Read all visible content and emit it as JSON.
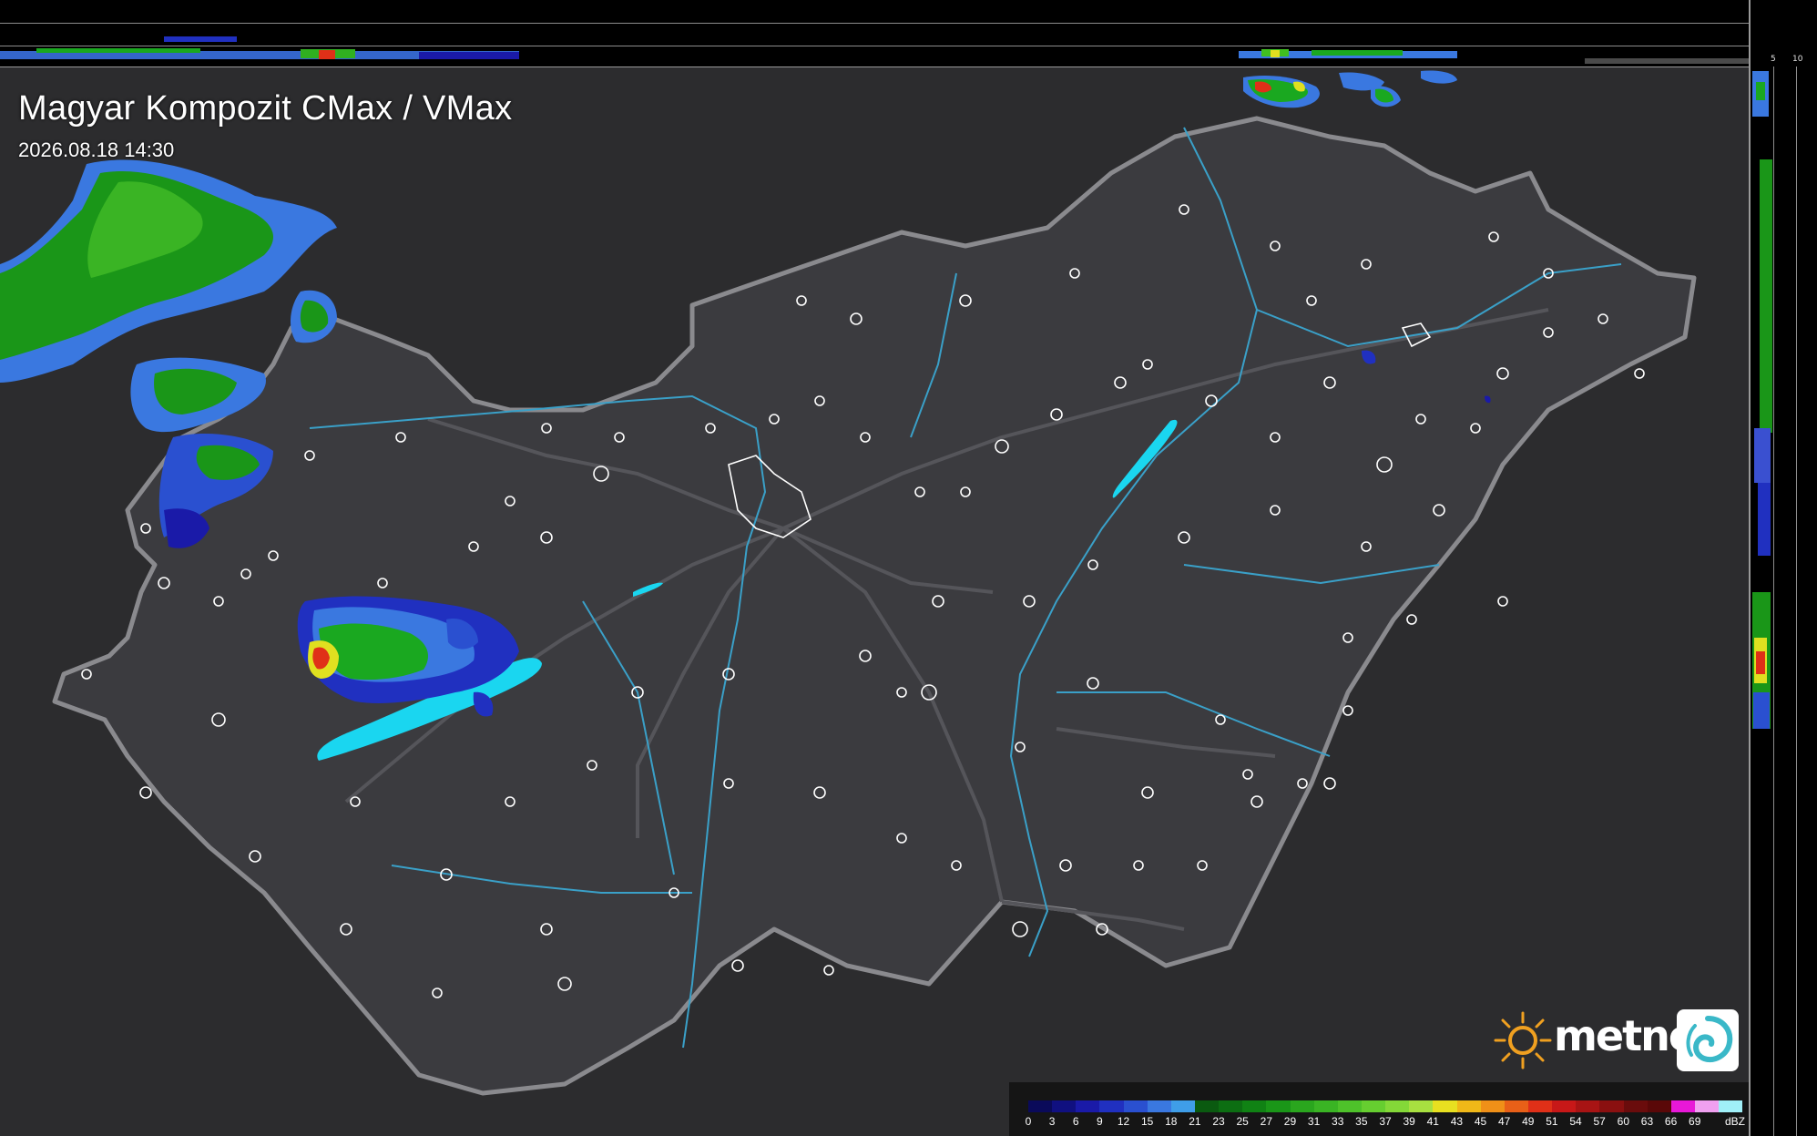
{
  "title": "Magyar Kompozit CMax / VMax",
  "timestamp": "2026.08.18 14:30",
  "top_strip": {
    "scale_labels": [
      "10",
      "5"
    ]
  },
  "right_strip": {
    "scale_labels": [
      "5",
      "10"
    ]
  },
  "logo": {
    "text": "metnet",
    "sun_icon": "sun-icon",
    "swirl_icon": "swirl-icon"
  },
  "colors": {
    "background": "#000000",
    "terrain": "#2c2c2e",
    "country": "#3b3b3f",
    "border": "#8a8a8e",
    "rivers": "#3aa0c8",
    "lakes": "#1ad6f0",
    "settlements": "#ffffff"
  },
  "scale": {
    "unit": "dBZ",
    "labels": [
      "0",
      "3",
      "6",
      "9",
      "12",
      "15",
      "18",
      "21",
      "23",
      "25",
      "27",
      "29",
      "31",
      "33",
      "35",
      "37",
      "39",
      "41",
      "43",
      "45",
      "47",
      "49",
      "51",
      "54",
      "57",
      "60",
      "63",
      "66",
      "69"
    ],
    "colors": [
      "#0a0a5a",
      "#101080",
      "#1a1aa8",
      "#2030c0",
      "#2a50d0",
      "#3a78e0",
      "#3f9ee8",
      "#0a5a10",
      "#0c6e12",
      "#108214",
      "#1a9618",
      "#2aa61e",
      "#3ab424",
      "#4ec22a",
      "#66ce30",
      "#84d838",
      "#a8e040",
      "#e8e020",
      "#f0b818",
      "#f09018",
      "#e86018",
      "#e03018",
      "#c81818",
      "#a81414",
      "#8a1010",
      "#6a0c0c",
      "#5a0808",
      "#e818d8",
      "#f0a0f0",
      "#a0f0f8"
    ]
  }
}
